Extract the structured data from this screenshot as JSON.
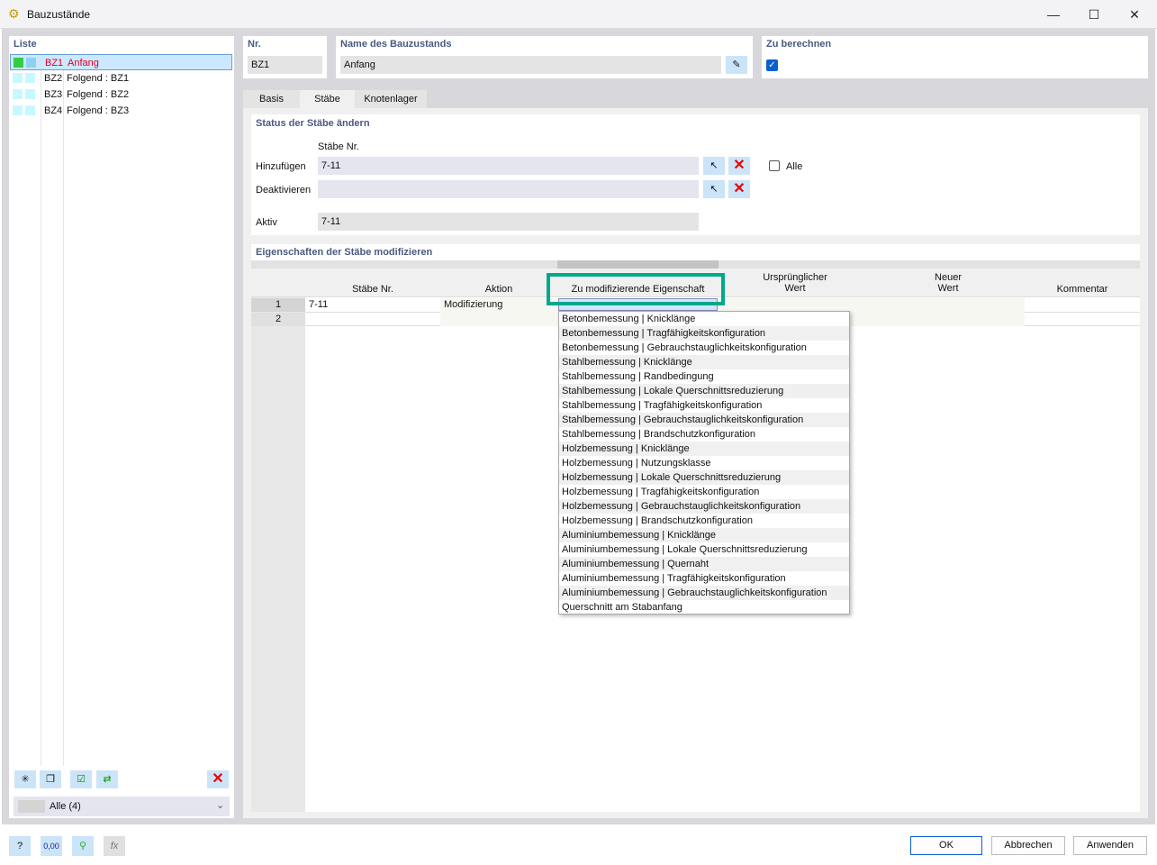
{
  "window": {
    "title": "Bauzustände"
  },
  "list": {
    "header": "Liste",
    "items": [
      {
        "id": "BZ1",
        "name": "Anfang",
        "selected": true
      },
      {
        "id": "BZ2",
        "name": "Folgend : BZ1"
      },
      {
        "id": "BZ3",
        "name": "Folgend : BZ2"
      },
      {
        "id": "BZ4",
        "name": "Folgend : BZ3"
      }
    ],
    "filter": "Alle (4)"
  },
  "nr": {
    "label": "Nr.",
    "value": "BZ1"
  },
  "name": {
    "label": "Name des Bauzustands",
    "value": "Anfang"
  },
  "calc": {
    "label": "Zu berechnen",
    "checked": true
  },
  "tabs": [
    {
      "label": "Basis"
    },
    {
      "label": "Stäbe",
      "active": true
    },
    {
      "label": "Knotenlager"
    }
  ],
  "status": {
    "header": "Status der Stäbe ändern",
    "col_label": "Stäbe Nr.",
    "add_label": "Hinzufügen",
    "add_value": "7-11",
    "deact_label": "Deaktivieren",
    "deact_value": "",
    "all_label": "Alle",
    "active_label": "Aktiv",
    "active_value": "7-11"
  },
  "props": {
    "header": "Eigenschaften der Stäbe modifizieren",
    "columns": [
      "Stäbe Nr.",
      "Aktion",
      "Zu modifizierende Eigenschaft",
      "Ursprünglicher",
      "Wert",
      "Neuer",
      "Wert",
      "Kommentar"
    ],
    "rows": [
      {
        "n": "1",
        "members": "7-11",
        "action": "Modifizierung"
      },
      {
        "n": "2",
        "members": "",
        "action": ""
      }
    ],
    "highlight_color": "#00a88a",
    "dropdown": [
      "Betonbemessung | Knicklänge",
      "Betonbemessung | Tragfähigkeitskonfiguration",
      "Betonbemessung | Gebrauchstauglichkeitskonfiguration",
      "Stahlbemessung | Knicklänge",
      "Stahlbemessung | Randbedingung",
      "Stahlbemessung | Lokale Querschnittsreduzierung",
      "Stahlbemessung | Tragfähigkeitskonfiguration",
      "Stahlbemessung | Gebrauchstauglichkeitskonfiguration",
      "Stahlbemessung | Brandschutzkonfiguration",
      "Holzbemessung | Knicklänge",
      "Holzbemessung | Nutzungsklasse",
      "Holzbemessung | Lokale Querschnittsreduzierung",
      "Holzbemessung | Tragfähigkeitskonfiguration",
      "Holzbemessung | Gebrauchstauglichkeitskonfiguration",
      "Holzbemessung | Brandschutzkonfiguration",
      "Aluminiumbemessung | Knicklänge",
      "Aluminiumbemessung | Lokale Querschnittsreduzierung",
      "Aluminiumbemessung | Quernaht",
      "Aluminiumbemessung | Tragfähigkeitskonfiguration",
      "Aluminiumbemessung | Gebrauchstauglichkeitskonfiguration",
      "Querschnitt am Stabanfang"
    ]
  },
  "footer": {
    "ok": "OK",
    "cancel": "Abbrechen",
    "apply": "Anwenden",
    "units_icon_text": "0,00"
  }
}
